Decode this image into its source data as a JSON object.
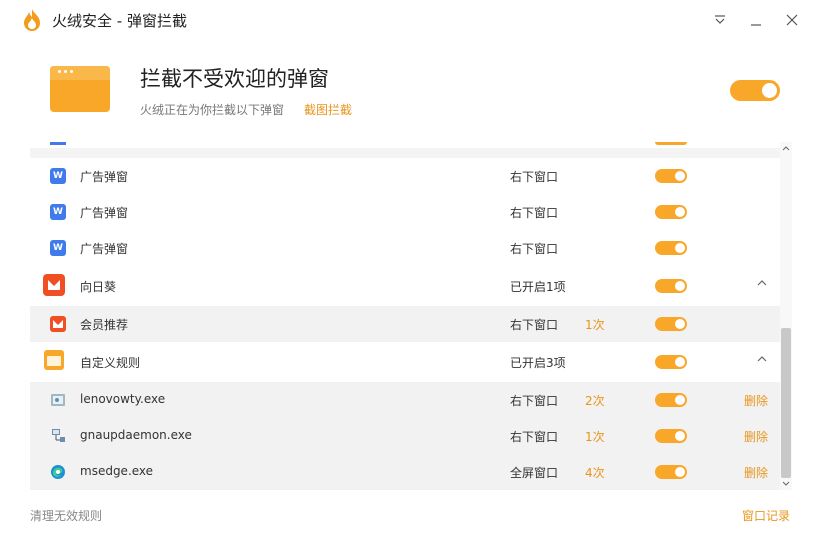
{
  "window": {
    "title": "火绒安全 - 弹窗拦截",
    "menu_icon": "menu-down-icon",
    "minimize_icon": "minimize-icon",
    "close_icon": "close-icon"
  },
  "header": {
    "title": "拦截不受欢迎的弹窗",
    "subtitle": "火绒正在为你拦截以下弹窗",
    "screenshot_link": "截图拦截",
    "master_toggle_on": true
  },
  "list": {
    "rows": [
      {
        "type": "child",
        "icon": "wps-icon",
        "name": "广告弹窗",
        "position": "右下窗口",
        "count": "",
        "enabled": true
      },
      {
        "type": "child",
        "icon": "wps-icon",
        "name": "广告弹窗",
        "position": "右下窗口",
        "count": "",
        "enabled": true
      },
      {
        "type": "child",
        "icon": "wps-icon",
        "name": "广告弹窗",
        "position": "右下窗口",
        "count": "",
        "enabled": true
      },
      {
        "type": "group",
        "icon": "sunlogin-icon",
        "name": "向日葵",
        "position": "已开启1项",
        "count": "",
        "enabled": true,
        "expanded": true
      },
      {
        "type": "child",
        "icon": "sunlogin-icon",
        "name": "会员推荐",
        "position": "右下窗口",
        "count": "1次",
        "enabled": true
      },
      {
        "type": "group",
        "icon": "custom-rule-icon",
        "name": "自定义规则",
        "position": "已开启3项",
        "count": "",
        "enabled": true,
        "expanded": true
      },
      {
        "type": "child",
        "icon": "lenovo-app-icon",
        "name": "lenovowty.exe",
        "position": "右下窗口",
        "count": "2次",
        "enabled": true,
        "delete": "删除"
      },
      {
        "type": "child",
        "icon": "network-app-icon",
        "name": "gnaupdaemon.exe",
        "position": "右下窗口",
        "count": "1次",
        "enabled": true,
        "delete": "删除"
      },
      {
        "type": "child",
        "icon": "edge-icon",
        "name": "msedge.exe",
        "position": "全屏窗口",
        "count": "4次",
        "enabled": true,
        "delete": "删除"
      }
    ]
  },
  "footer": {
    "clear_invalid": "清理无效规则",
    "window_log": "窗口记录"
  },
  "colors": {
    "accent": "#f9a729",
    "link": "#e8951d",
    "wps_blue": "#3f7bea",
    "sunlogin_red": "#f04e23"
  }
}
